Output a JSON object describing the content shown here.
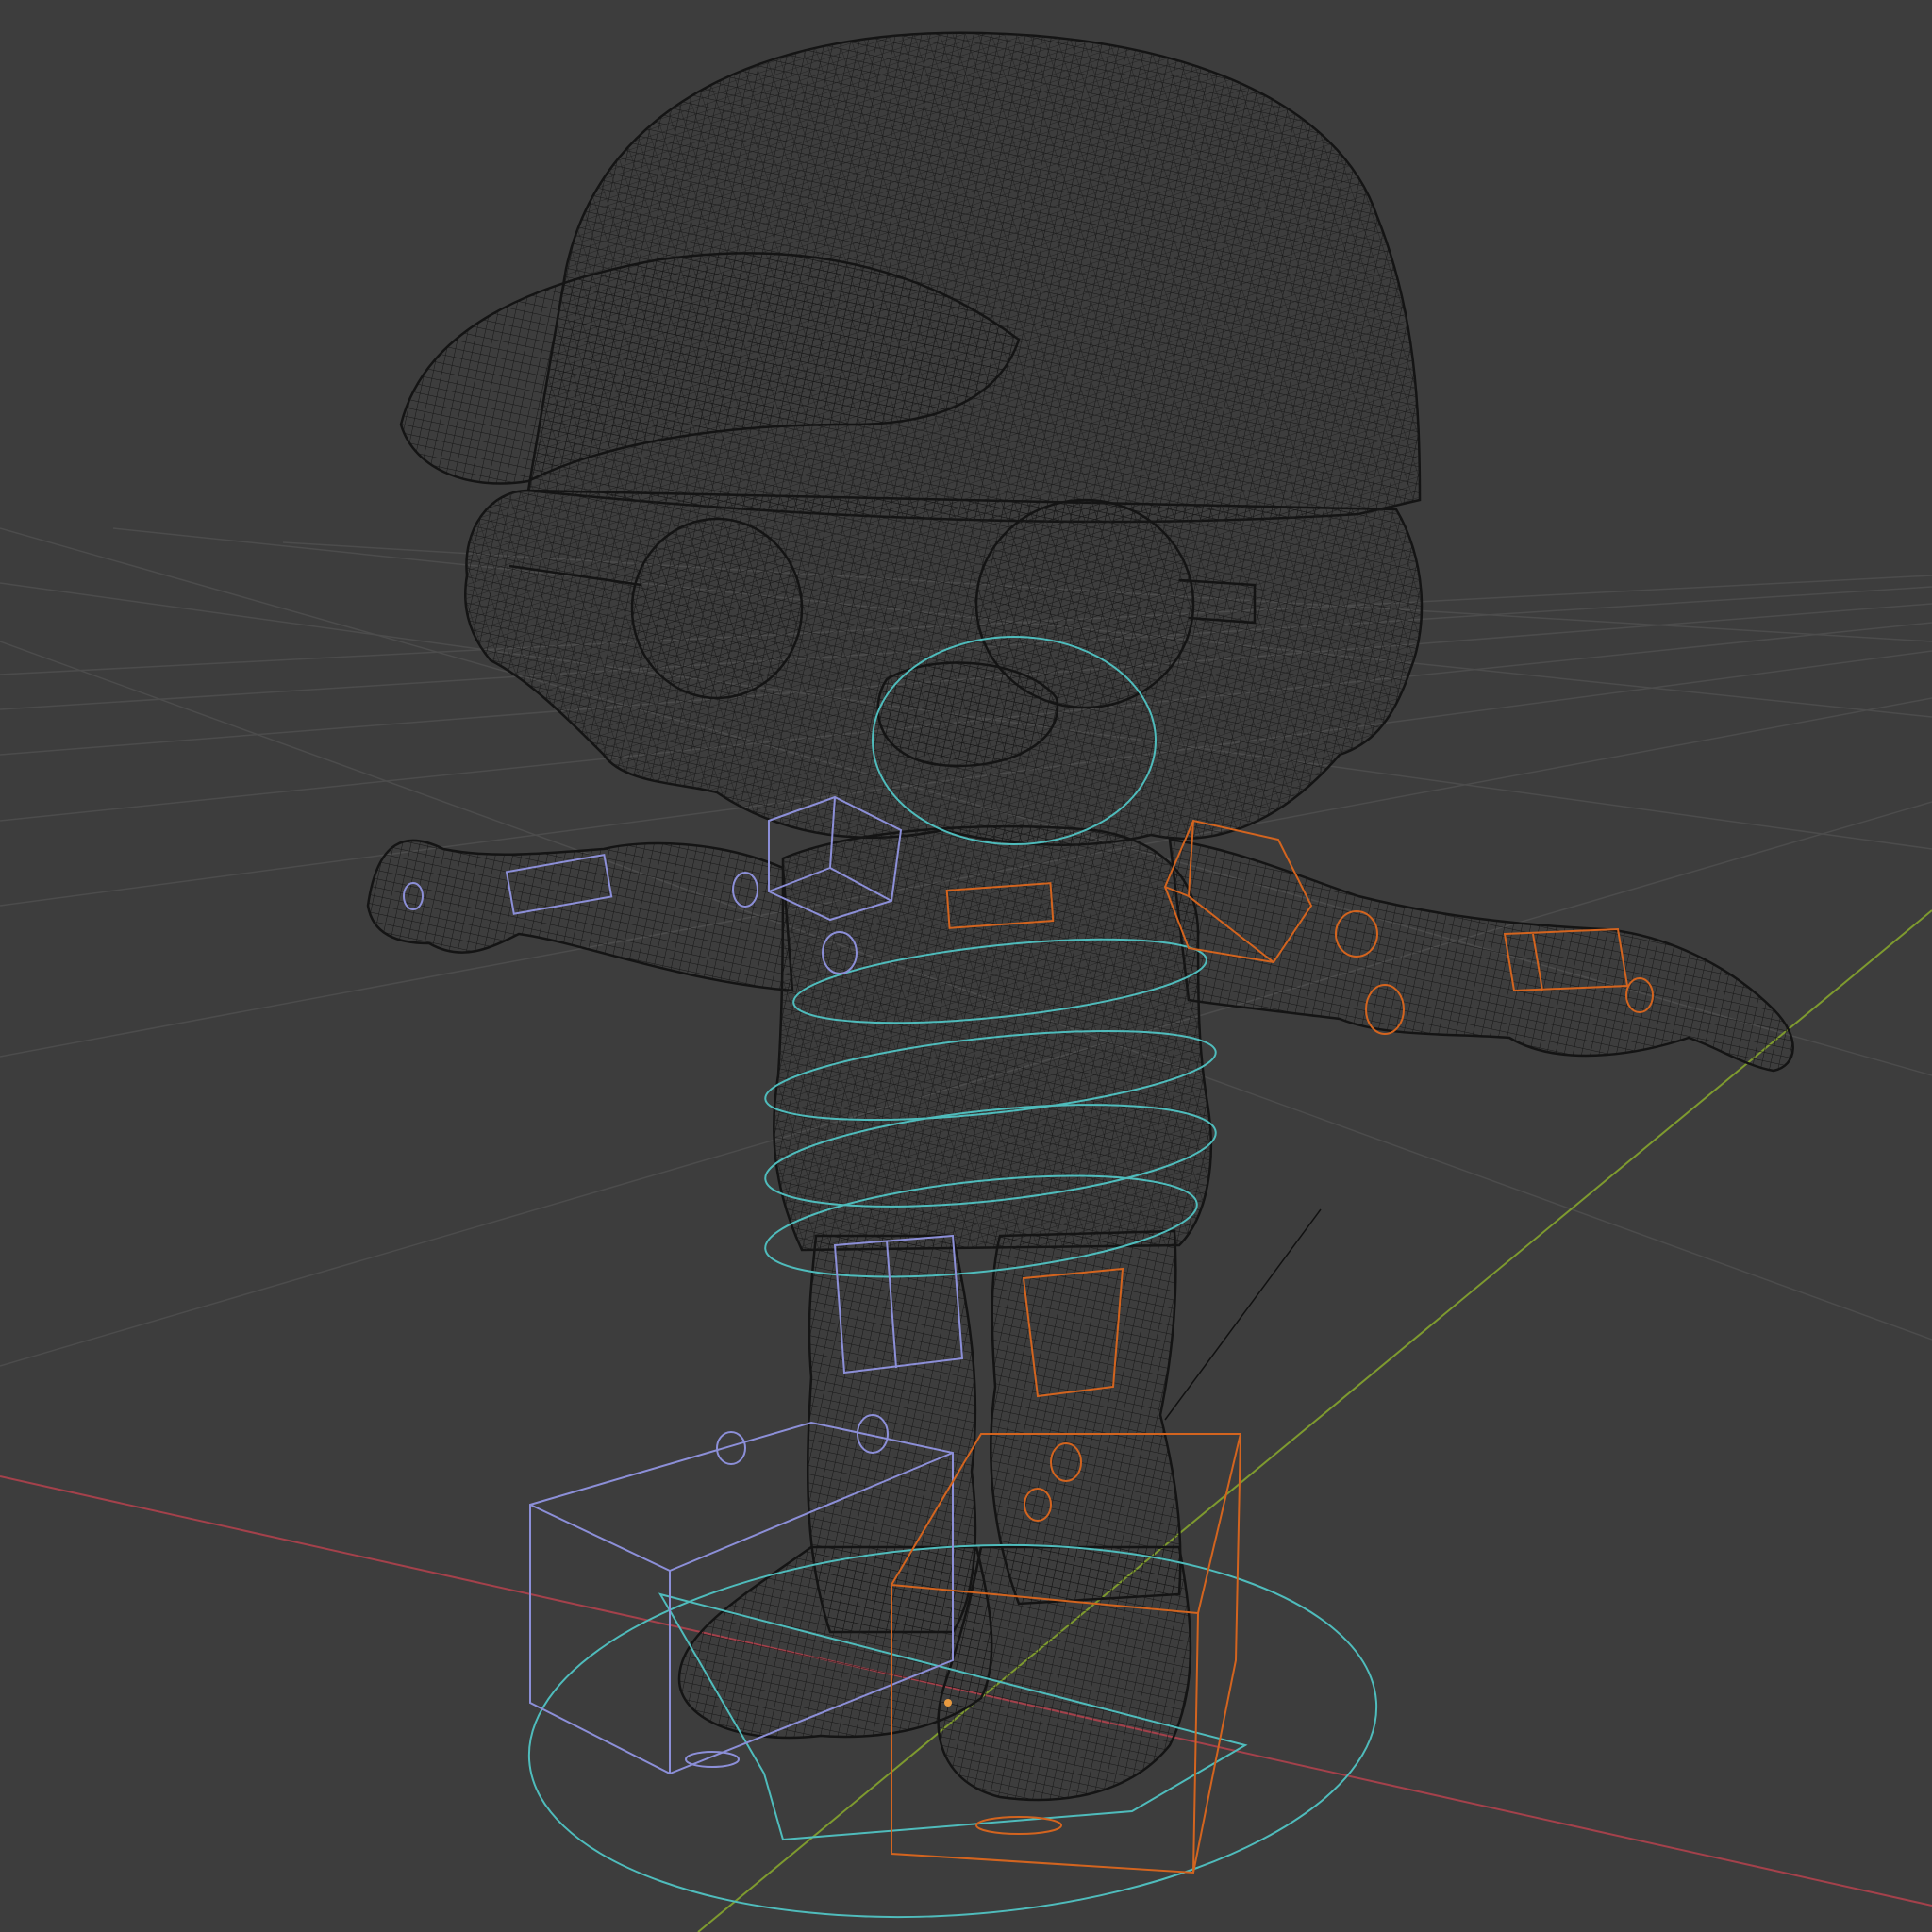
{
  "viewport": {
    "background": "#3d3d3d",
    "mode": "wireframe"
  },
  "colors": {
    "grid_line": "#4a4a4a",
    "axis_x": "#a4414b",
    "axis_y": "#7e9a2f",
    "mesh_wire": "#151515",
    "control_cyan": "#4fbcbc",
    "control_left": "#8c8fd8",
    "control_right": "#d3641f",
    "light_line": "#111111"
  },
  "icons": {
    "x_axis": "x-axis-line",
    "y_axis": "y-axis-line",
    "origin": "object-origin-dot"
  }
}
